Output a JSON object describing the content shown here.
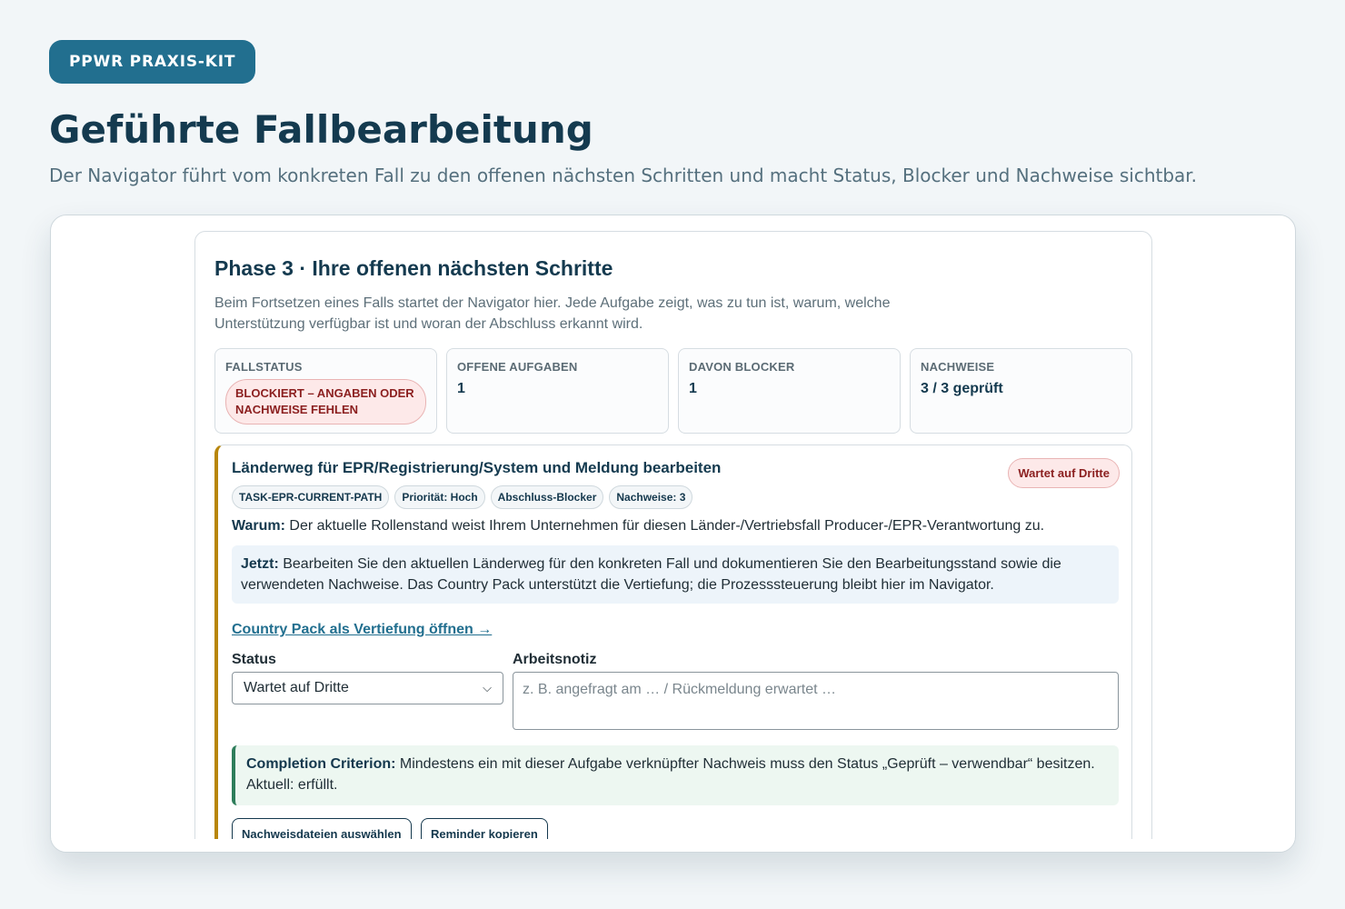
{
  "badge": "PPWR PRAXIS-KIT",
  "hero": {
    "title": "Geführte Fallbearbeitung",
    "subtitle": "Der Navigator führt vom konkreten Fall zu den offenen nächsten Schritten und macht Status, Blocker und Nachweise sichtbar."
  },
  "phase": {
    "title": "Phase 3 · Ihre offenen nächsten Schritte",
    "description": "Beim Fortsetzen eines Falls startet der Navigator hier. Jede Aufgabe zeigt, was zu tun ist, warum, welche Unterstützung verfügbar ist und woran der Abschluss erkannt wird."
  },
  "stats": {
    "fallstatus_label": "FALLSTATUS",
    "fallstatus_value": "BLOCKIERT – ANGABEN ODER NACHWEISE FEHLEN",
    "offen_label": "OFFENE AUFGABEN",
    "offen_value": "1",
    "blocker_label": "DAVON BLOCKER",
    "blocker_value": "1",
    "nachweise_label": "NACHWEISE",
    "nachweise_value": "3 / 3 geprüft"
  },
  "task": {
    "title": "Länderweg für EPR/Registrierung/System und Meldung bearbeiten",
    "status_badge": "Wartet auf Dritte",
    "chips": [
      "TASK-EPR-CURRENT-PATH",
      "Priorität: Hoch",
      "Abschluss-Blocker",
      "Nachweise: 3"
    ],
    "why_label": "Warum:",
    "why_text": "Der aktuelle Rollenstand weist Ihrem Unternehmen für diesen Länder-/Vertriebsfall Producer-/EPR-Verantwortung zu.",
    "now_label": "Jetzt:",
    "now_text": "Bearbeiten Sie den aktuellen Länderweg für den konkreten Fall und dokumentieren Sie den Bearbeitungsstand sowie die verwendeten Nachweise. Das Country Pack unterstützt die Vertiefung; die Prozesssteuerung bleibt hier im Navigator.",
    "link": "Country Pack als Vertiefung öffnen →",
    "status_label": "Status",
    "status_value": "Wartet auf Dritte",
    "note_label": "Arbeitsnotiz",
    "note_placeholder": "z. B. angefragt am … / Rückmeldung erwartet …",
    "criterion_label": "Completion Criterion:",
    "criterion_text": "Mindestens ein mit dieser Aufgabe verknüpfter Nachweis muss den Status „Geprüft – verwendbar“ besitzen. Aktuell: erfüllt.",
    "btn_files": "Nachweisdateien auswählen",
    "btn_reminder": "Reminder kopieren"
  }
}
